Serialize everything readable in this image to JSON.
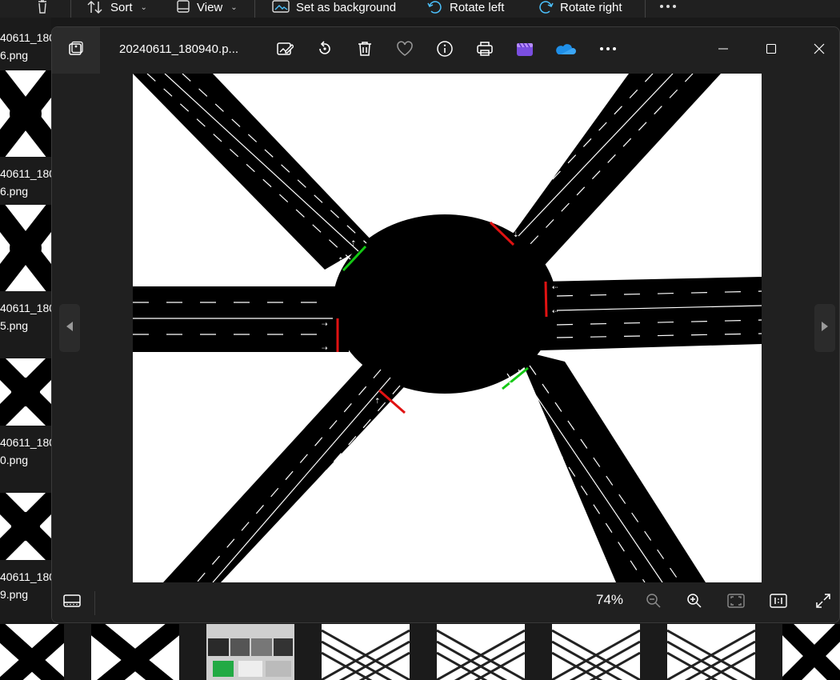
{
  "explorer": {
    "command_bar": {
      "delete_icon": "trash-icon",
      "sort_label": "Sort",
      "view_label": "View",
      "set_background_label": "Set as background",
      "rotate_left_label": "Rotate left",
      "rotate_right_label": "Rotate right",
      "more_icon": "more-icon"
    },
    "left_thumbnails": [
      {
        "caption_line1": "40611_180",
        "caption_line2": "6.png"
      },
      {
        "caption_line1": "40611_180",
        "caption_line2": "6.png"
      },
      {
        "caption_line1": "40611_180",
        "caption_line2": "5.png"
      },
      {
        "caption_line1": "40611_180",
        "caption_line2": "0.png"
      },
      {
        "caption_line1": "40611_180",
        "caption_line2": "9.png"
      }
    ]
  },
  "viewer": {
    "file_name": "20240611_180940.p...",
    "toolbar_icons": [
      "edit-image-icon",
      "rotate-icon",
      "trash-icon",
      "favorite-heart-icon",
      "info-icon",
      "print-icon",
      "clipchamp-icon",
      "onedrive-icon",
      "more-icon"
    ],
    "window_controls": [
      "minimize-icon",
      "maximize-icon",
      "close-icon"
    ],
    "zoom_label": "74%",
    "bottom_icons": [
      "filmstrip-icon",
      "zoom-out-icon",
      "zoom-in-icon",
      "fit-to-window-icon",
      "actual-size-icon",
      "fullscreen-icon"
    ],
    "colors": {
      "window_bg": "#202020",
      "signal_green": "#14c814",
      "signal_red": "#e01212",
      "road": "#000000"
    }
  }
}
